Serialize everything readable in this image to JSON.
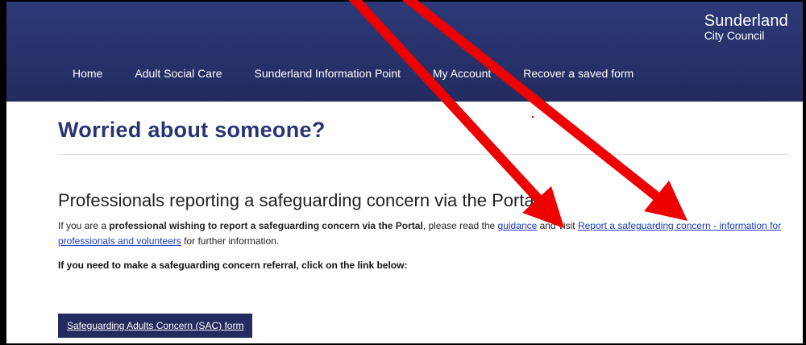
{
  "logo": {
    "line1": "Sunderland",
    "line2": "City Council"
  },
  "nav": {
    "items": [
      {
        "label": "Home"
      },
      {
        "label": "Adult Social Care"
      },
      {
        "label": "Sunderland Information Point"
      },
      {
        "label": "My Account"
      },
      {
        "label": "Recover a saved form"
      }
    ]
  },
  "page": {
    "title": "Worried about someone?",
    "section_title": "Professionals reporting a safeguarding concern via the Portal",
    "para": {
      "part1": "If you are a ",
      "bold": "professional wishing to report a safeguarding concern via the Portal",
      "part2": ", please read the ",
      "link_guidance": "guidance",
      "part3": " and visit ",
      "link_report": "Report a safeguarding concern - information for professionals and volunteers",
      "part4": " for further information."
    },
    "instruction": "If you need to make a safeguarding concern referral, click on the link below:",
    "sac_button": "Safeguarding Adults Concern (SAC) form"
  },
  "colors": {
    "header_bg": "#27316a",
    "title": "#2b3472",
    "link": "#1d39c4",
    "button_bg": "#232b5f",
    "annotation_arrow": "#ee0000"
  }
}
